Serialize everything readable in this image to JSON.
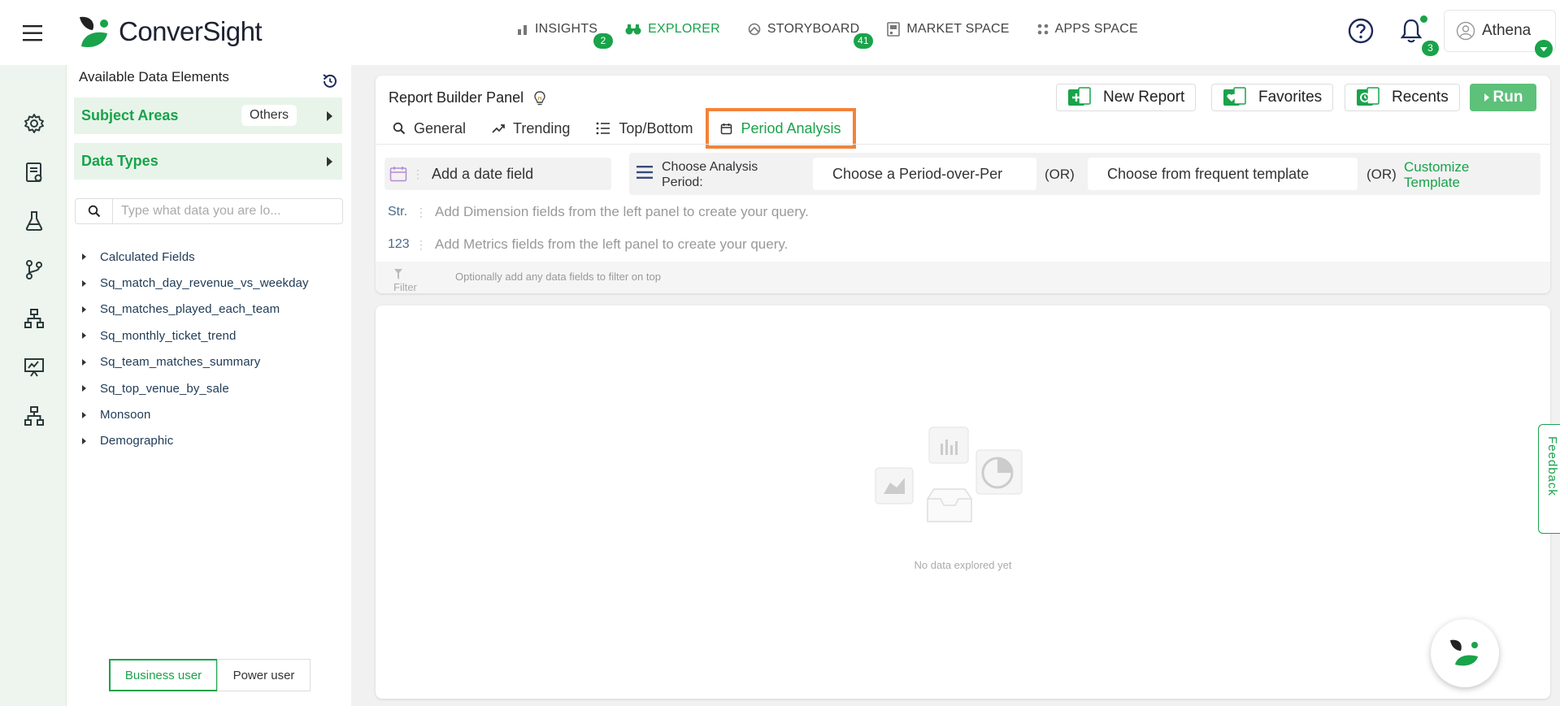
{
  "app": {
    "logo_text": "ConverSight"
  },
  "nav": {
    "items": [
      {
        "label": "INSIGHTS",
        "icon": "bar-chart-icon",
        "badge": "2"
      },
      {
        "label": "EXPLORER",
        "icon": "binoculars-icon",
        "active": true
      },
      {
        "label": "STORYBOARD",
        "icon": "storyboard-icon",
        "badge": "41"
      },
      {
        "label": "MARKET SPACE",
        "icon": "market-icon"
      },
      {
        "label": "APPS SPACE",
        "icon": "apps-grid-icon"
      }
    ],
    "notifications_count": "3",
    "user_name": "Athena"
  },
  "rail": {
    "icons": [
      "settings-icon",
      "report-icon",
      "flask-icon",
      "git-branch-icon",
      "hierarchy-icon",
      "presentation-icon",
      "org-chart-icon"
    ]
  },
  "data_panel": {
    "title": "Available Data Elements",
    "subject_areas_label": "Subject Areas",
    "subject_area_value": "Others",
    "data_types_label": "Data Types",
    "search_placeholder": "Type what data you are lo...",
    "tree": [
      "Calculated Fields",
      "Sq_match_day_revenue_vs_weekday",
      "Sq_matches_played_each_team",
      "Sq_monthly_ticket_trend",
      "Sq_team_matches_summary",
      "Sq_top_venue_by_sale",
      "Monsoon",
      "Demographic"
    ],
    "mode_business": "Business user",
    "mode_power": "Power user"
  },
  "report_builder": {
    "title": "Report Builder Panel",
    "new_report": "New Report",
    "favorites": "Favorites",
    "recents": "Recents",
    "run": "Run",
    "tabs": [
      {
        "label": "General",
        "icon": "search-icon"
      },
      {
        "label": "Trending",
        "icon": "trend-icon"
      },
      {
        "label": "Top/Bottom",
        "icon": "list-icon"
      },
      {
        "label": "Period Analysis",
        "icon": "calendar-icon",
        "active": true
      }
    ],
    "date_field": "Add a date field",
    "period_label_1": "Choose Analysis",
    "period_label_2": "Period:",
    "period_select": "Choose a Period-over-Per",
    "template_select": "Choose from frequent template",
    "or_text": "(OR)",
    "customize_1": "Customize",
    "customize_2": "Template",
    "dim_tag": "Str.",
    "dim_hint": "Add Dimension fields from the left panel to create your query.",
    "metric_tag": "123",
    "metric_hint": "Add Metrics fields from the left panel to create your query.",
    "filter_label": "Filter",
    "filter_hint": "Optionally add any data fields to filter on top"
  },
  "result": {
    "empty_text": "No data explored yet"
  },
  "feedback_label": "Feedback",
  "colors": {
    "accent": "#19a34a",
    "tab_highlight": "#f2833a",
    "rail_bg": "#eef5ee"
  }
}
